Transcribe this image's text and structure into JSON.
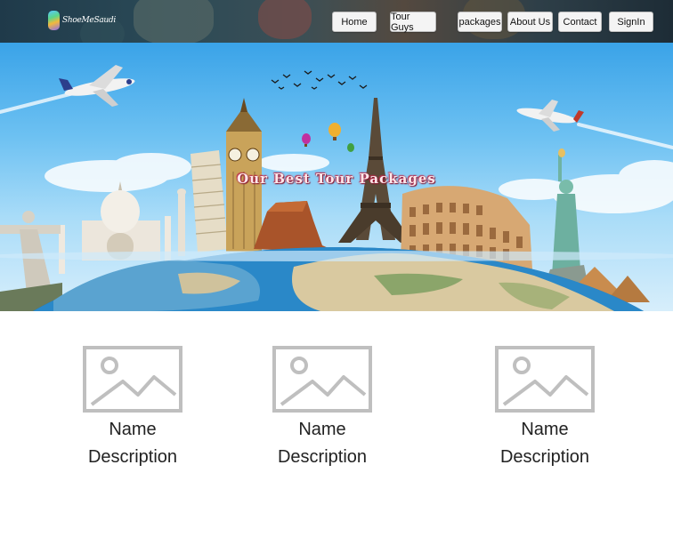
{
  "brand": {
    "logo_text": "ShoeMeSaudi"
  },
  "nav": {
    "home": "Home",
    "tour_guys": "Tour Guys",
    "packages": "packages",
    "about_us": "About Us",
    "contact": "Contact",
    "signin": "SignIn"
  },
  "hero": {
    "title": "Our Best Tour Packages"
  },
  "cards": [
    {
      "name": "Name",
      "description": "Description"
    },
    {
      "name": "Name",
      "description": "Description"
    },
    {
      "name": "Name",
      "description": "Description"
    }
  ]
}
